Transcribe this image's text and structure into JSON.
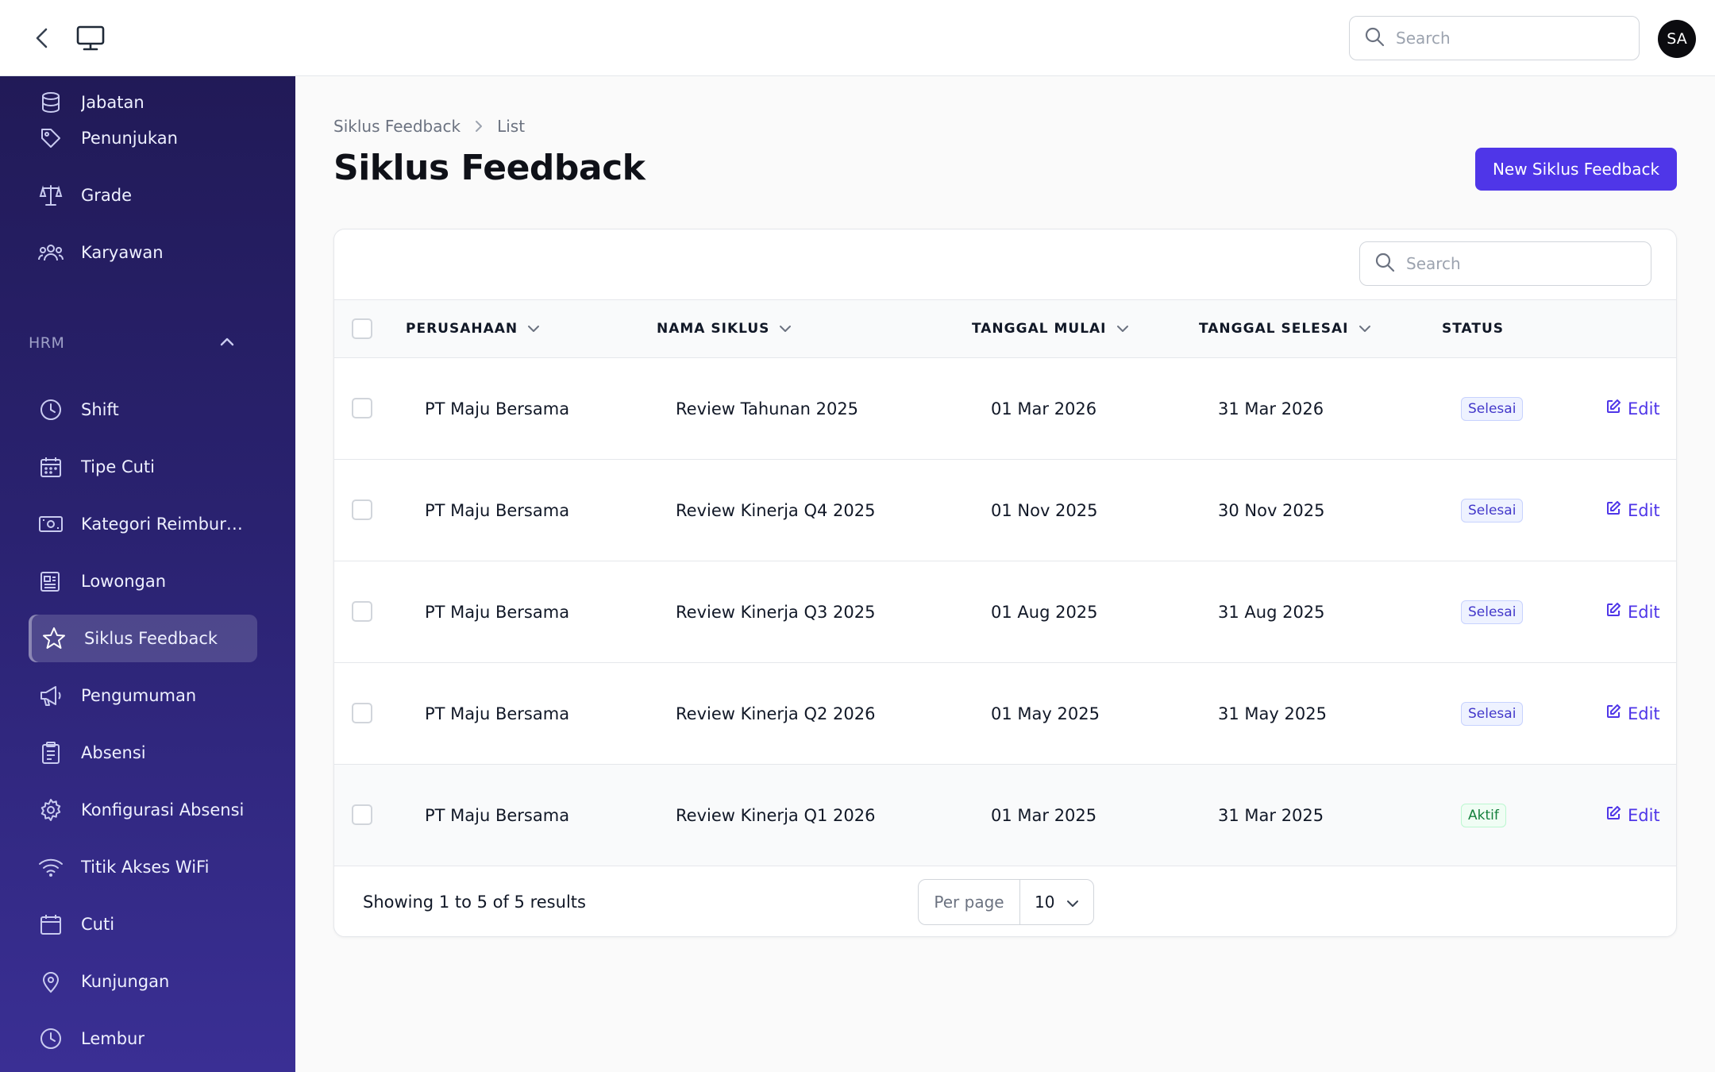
{
  "topbar": {
    "search_placeholder": "Search",
    "avatar_initials": "SA"
  },
  "sidebar": {
    "top_items": [
      {
        "label": "Jabatan",
        "icon": "database-icon"
      },
      {
        "label": "Penunjukan",
        "icon": "tag-icon"
      },
      {
        "label": "Grade",
        "icon": "scale-icon"
      },
      {
        "label": "Karyawan",
        "icon": "users-icon"
      }
    ],
    "group_label": "HRM",
    "items": [
      {
        "label": "Shift",
        "icon": "clock-icon"
      },
      {
        "label": "Tipe Cuti",
        "icon": "calendar-days-icon"
      },
      {
        "label": "Kategori Reimbursement",
        "icon": "cash-icon"
      },
      {
        "label": "Lowongan",
        "icon": "newspaper-icon"
      },
      {
        "label": "Siklus Feedback",
        "icon": "star-icon",
        "active": true
      },
      {
        "label": "Pengumuman",
        "icon": "megaphone-icon"
      },
      {
        "label": "Absensi",
        "icon": "clipboard-icon"
      },
      {
        "label": "Konfigurasi Absensi",
        "icon": "gear-icon"
      },
      {
        "label": "Titik Akses WiFi",
        "icon": "wifi-icon"
      },
      {
        "label": "Cuti",
        "icon": "calendar-icon"
      },
      {
        "label": "Kunjungan",
        "icon": "map-pin-icon"
      },
      {
        "label": "Lembur",
        "icon": "clock-icon"
      }
    ]
  },
  "breadcrumb": {
    "parent": "Siklus Feedback",
    "current": "List"
  },
  "page": {
    "title": "Siklus Feedback",
    "new_button": "New Siklus Feedback"
  },
  "table": {
    "search_placeholder": "Search",
    "columns": [
      "PERUSAHAAN",
      "NAMA SIKLUS",
      "TANGGAL MULAI",
      "TANGGAL SELESAI",
      "STATUS"
    ],
    "edit_label": "Edit",
    "rows": [
      {
        "company": "PT Maju Bersama",
        "cycle": "Review Tahunan 2025",
        "start": "01 Mar 2026",
        "end": "31 Mar 2026",
        "status": "Selesai"
      },
      {
        "company": "PT Maju Bersama",
        "cycle": "Review Kinerja Q4 2025",
        "start": "01 Nov 2025",
        "end": "30 Nov 2025",
        "status": "Selesai"
      },
      {
        "company": "PT Maju Bersama",
        "cycle": "Review Kinerja Q3 2025",
        "start": "01 Aug 2025",
        "end": "31 Aug 2025",
        "status": "Selesai"
      },
      {
        "company": "PT Maju Bersama",
        "cycle": "Review Kinerja Q2 2026",
        "start": "01 May 2025",
        "end": "31 May 2025",
        "status": "Selesai"
      },
      {
        "company": "PT Maju Bersama",
        "cycle": "Review Kinerja Q1 2026",
        "start": "01 Mar 2025",
        "end": "31 Mar 2025",
        "status": "Aktif"
      }
    ],
    "showing": "Showing 1 to 5 of 5 results",
    "per_page_label": "Per page",
    "per_page_value": "10"
  },
  "colors": {
    "accent": "#4f36e8",
    "sidebar_top": "#211a57",
    "sidebar_bottom": "#3a2f94"
  }
}
